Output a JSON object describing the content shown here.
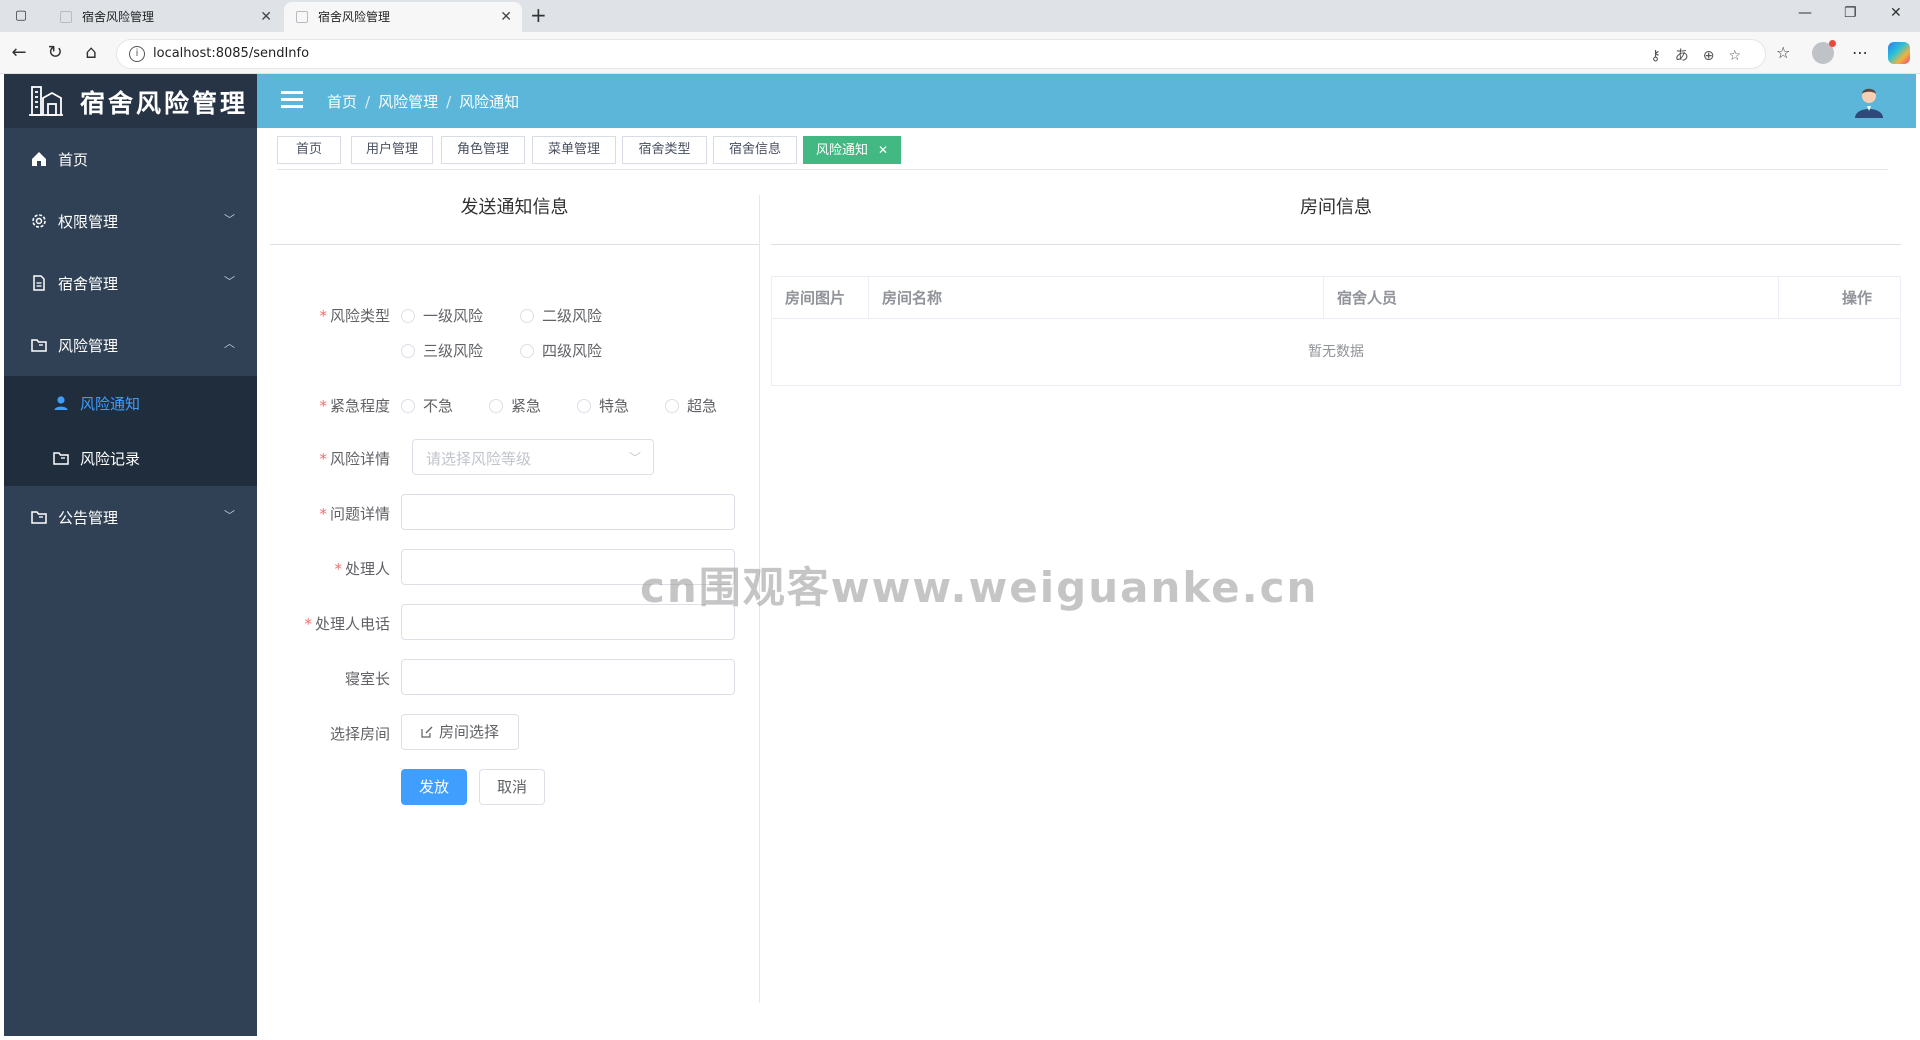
{
  "browser": {
    "tabs": [
      {
        "title": "宿舍风险管理",
        "active": false
      },
      {
        "title": "宿舍风险管理",
        "active": true
      }
    ],
    "url": "localhost:8085/sendInfo"
  },
  "sidebar": {
    "title": "宿舍风险管理",
    "items": [
      {
        "label": "首页",
        "icon": "home-icon"
      },
      {
        "label": "权限管理",
        "icon": "gear-icon"
      },
      {
        "label": "宿舍管理",
        "icon": "document-icon"
      },
      {
        "label": "风险管理",
        "icon": "folder-icon",
        "expanded": true
      },
      {
        "label": "公告管理",
        "icon": "folder-icon"
      }
    ],
    "sub_items": [
      {
        "label": "风险通知",
        "icon": "user-icon",
        "active": true
      },
      {
        "label": "风险记录",
        "icon": "folder-icon"
      }
    ],
    "colors": {
      "background": "#304156",
      "active": "#409eff"
    }
  },
  "header": {
    "breadcrumb": [
      "首页",
      "风险管理",
      "风险通知"
    ]
  },
  "tags": [
    "首页",
    "用户管理",
    "角色管理",
    "菜单管理",
    "宿舍类型",
    "宿舍信息",
    "风险通知"
  ],
  "form": {
    "title": "发送通知信息",
    "risk_type_label": "风险类型",
    "risk_types": [
      "一级风险",
      "二级风险",
      "三级风险",
      "四级风险"
    ],
    "urgency_label": "紧急程度",
    "urgency": [
      "不急",
      "紧急",
      "特急",
      "超急"
    ],
    "risk_detail_label": "风险详情",
    "risk_detail_placeholder": "请选择风险等级",
    "problem_label": "问题详情",
    "handler_label": "处理人",
    "handler_phone_label": "处理人电话",
    "room_leader_label": "寝室长",
    "room_select_label": "选择房间",
    "room_select_button": "房间选择",
    "submit": "发放",
    "cancel": "取消"
  },
  "room_table": {
    "title": "房间信息",
    "columns": [
      "房间图片",
      "房间名称",
      "宿舍人员",
      "操作"
    ],
    "empty_text": "暂无数据"
  },
  "watermark": "cn围观客www.weiguanke.cn"
}
